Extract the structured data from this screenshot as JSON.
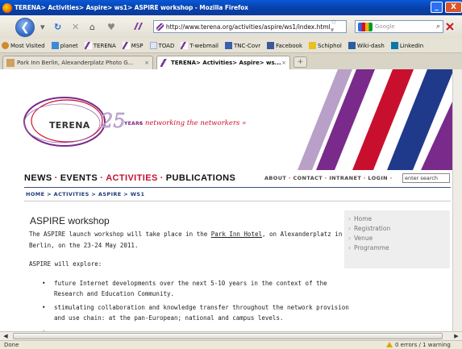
{
  "window": {
    "title": "TERENA> Activities> Aspire> ws1> ASPIRE workshop - Mozilla Firefox",
    "minimize_glyph": "_",
    "close_glyph": "X"
  },
  "toolbar": {
    "back_glyph": "❮",
    "url": "http://www.terena.org/activities/aspire/ws1/index.html",
    "search_placeholder": "Google"
  },
  "bookmarks": [
    {
      "label": "Most Visited",
      "icon": "gear-icon",
      "color": "#d08a2a"
    },
    {
      "label": "planet",
      "icon": "planet-icon",
      "color": "#3c8ad8"
    },
    {
      "label": "TERENA",
      "icon": "terena-icon",
      "color": "#7a3a9a"
    },
    {
      "label": "MSP",
      "icon": "terena-icon",
      "color": "#7a3a9a"
    },
    {
      "label": "TOAD",
      "icon": "page-icon",
      "color": "#9ab0d0"
    },
    {
      "label": "T-webmail",
      "icon": "terena-icon",
      "color": "#7a3a9a"
    },
    {
      "label": "TNC-Covr",
      "icon": "tnc-icon",
      "color": "#3a5fb0"
    },
    {
      "label": "Facebook",
      "icon": "facebook-icon",
      "color": "#3b5998"
    },
    {
      "label": "Schiphol",
      "icon": "schiphol-icon",
      "color": "#e8c020"
    },
    {
      "label": "Wiki-dash",
      "icon": "wiki-icon",
      "color": "#2a5ea0"
    },
    {
      "label": "LinkedIn",
      "icon": "linkedin-icon",
      "color": "#0e76a8"
    }
  ],
  "tabs": [
    {
      "label": "Park Inn Berlin, Alexanderplatz Photo G...",
      "close": "×"
    },
    {
      "label": "TERENA> Activities> Aspire> ws...",
      "close": "×"
    }
  ],
  "newtab_label": "+",
  "site": {
    "logo_text": "TERENA",
    "years_text": "YEARS",
    "tagline": "« networking the networkers »",
    "main_nav": [
      "NEWS",
      "EVENTS",
      "ACTIVITIES",
      "PUBLICATIONS"
    ],
    "main_nav_sep": "·",
    "top_nav": [
      "ABOUT",
      "CONTACT",
      "INTRANET",
      "LOGIN"
    ],
    "top_nav_sep": " · ",
    "search_placeholder": "enter search",
    "breadcrumb": "HOME > ACTIVITIES > ASPIRE > WS1"
  },
  "article": {
    "heading": "ASPIRE workshop",
    "intro_1": "The ASPIRE launch workshop will take place in the ",
    "intro_link": "Park Inn Hotel",
    "intro_2": ", on Alexanderplatz in",
    "intro_3": "Berlin, on the 23-24 May 2011.",
    "explore": "ASPIRE will explore:",
    "bullets": [
      {
        "line1": "future Internet developments over the next 5-10 years in the context of the",
        "line2": "Research and Education Community."
      },
      {
        "line1": "stimulating collaboration and knowledge transfer throughout the network provision",
        "line2": "and use chain: at the pan-European; national and campus levels."
      }
    ],
    "bullet_glyph": "•"
  },
  "sidebar": {
    "arrow": "›",
    "items": [
      "Home",
      "Registration",
      "Venue",
      "Programme"
    ]
  },
  "status": {
    "text": "Done",
    "warnings": "0 errors / 1 warning"
  },
  "colors": {
    "accent_red": "#c8102e",
    "accent_purple": "#7a2a8a",
    "accent_blue": "#1f3a78"
  }
}
